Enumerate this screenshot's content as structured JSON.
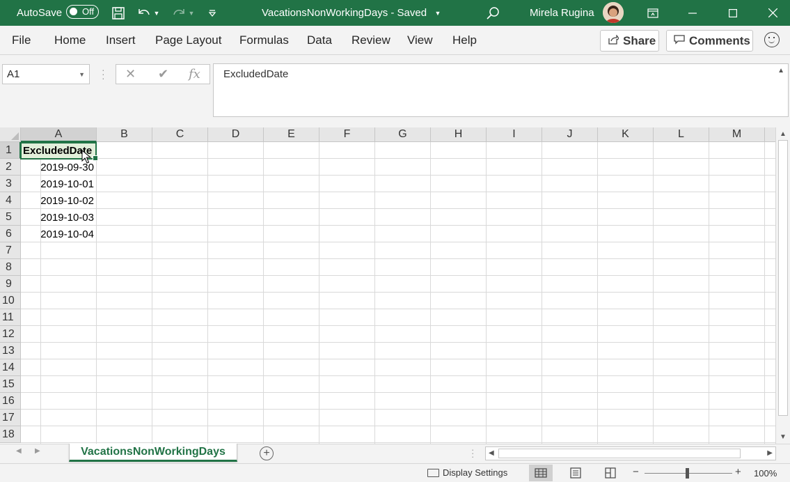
{
  "titlebar": {
    "autosave_label": "AutoSave",
    "autosave_state": "Off",
    "document_title": "VacationsNonWorkingDays  -  Saved",
    "user_name": "Mirela Rugina"
  },
  "ribbon": {
    "tabs": [
      "File",
      "Home",
      "Insert",
      "Page Layout",
      "Formulas",
      "Data",
      "Review",
      "View",
      "Help"
    ],
    "share_label": "Share",
    "comments_label": "Comments"
  },
  "formula_bar": {
    "name_box": "A1",
    "content": "ExcludedDate"
  },
  "grid": {
    "columns": [
      "A",
      "B",
      "C",
      "D",
      "E",
      "F",
      "G",
      "H",
      "I",
      "J",
      "K",
      "L",
      "M"
    ],
    "rows": [
      "1",
      "2",
      "3",
      "4",
      "5",
      "6",
      "7",
      "8",
      "9",
      "10",
      "11",
      "12",
      "13",
      "14",
      "15",
      "16",
      "17",
      "18"
    ],
    "cells": {
      "A1": "ExcludedDate",
      "A2": "2019-09-30",
      "A3": "2019-10-01",
      "A4": "2019-10-02",
      "A5": "2019-10-03",
      "A6": "2019-10-04"
    }
  },
  "sheets": {
    "active": "VacationsNonWorkingDays"
  },
  "statusbar": {
    "display_settings": "Display Settings",
    "zoom": "100%"
  },
  "colors": {
    "excel_green": "#217346",
    "header_fill": "#e2efda"
  }
}
